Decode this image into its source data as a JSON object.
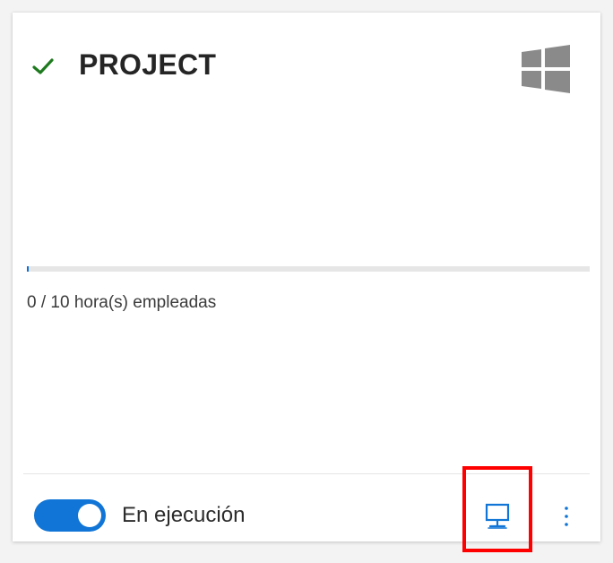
{
  "card": {
    "title": "PROJECT",
    "status_icon": "check-icon",
    "os_icon": "windows-icon"
  },
  "usage": {
    "used_hours": 0,
    "total_hours": 10,
    "progress_fraction": 0.0,
    "text": "0 / 10 hora(s) empleadas"
  },
  "footer": {
    "toggle_state": "on",
    "status_label": "En ejecución",
    "remote_icon": "remote-desktop-icon",
    "more_icon": "more-vertical-icon"
  },
  "colors": {
    "accent": "#1075d6",
    "check": "#1e7a1e",
    "os_icon": "#8a8a8a",
    "highlight": "#ff0000"
  }
}
